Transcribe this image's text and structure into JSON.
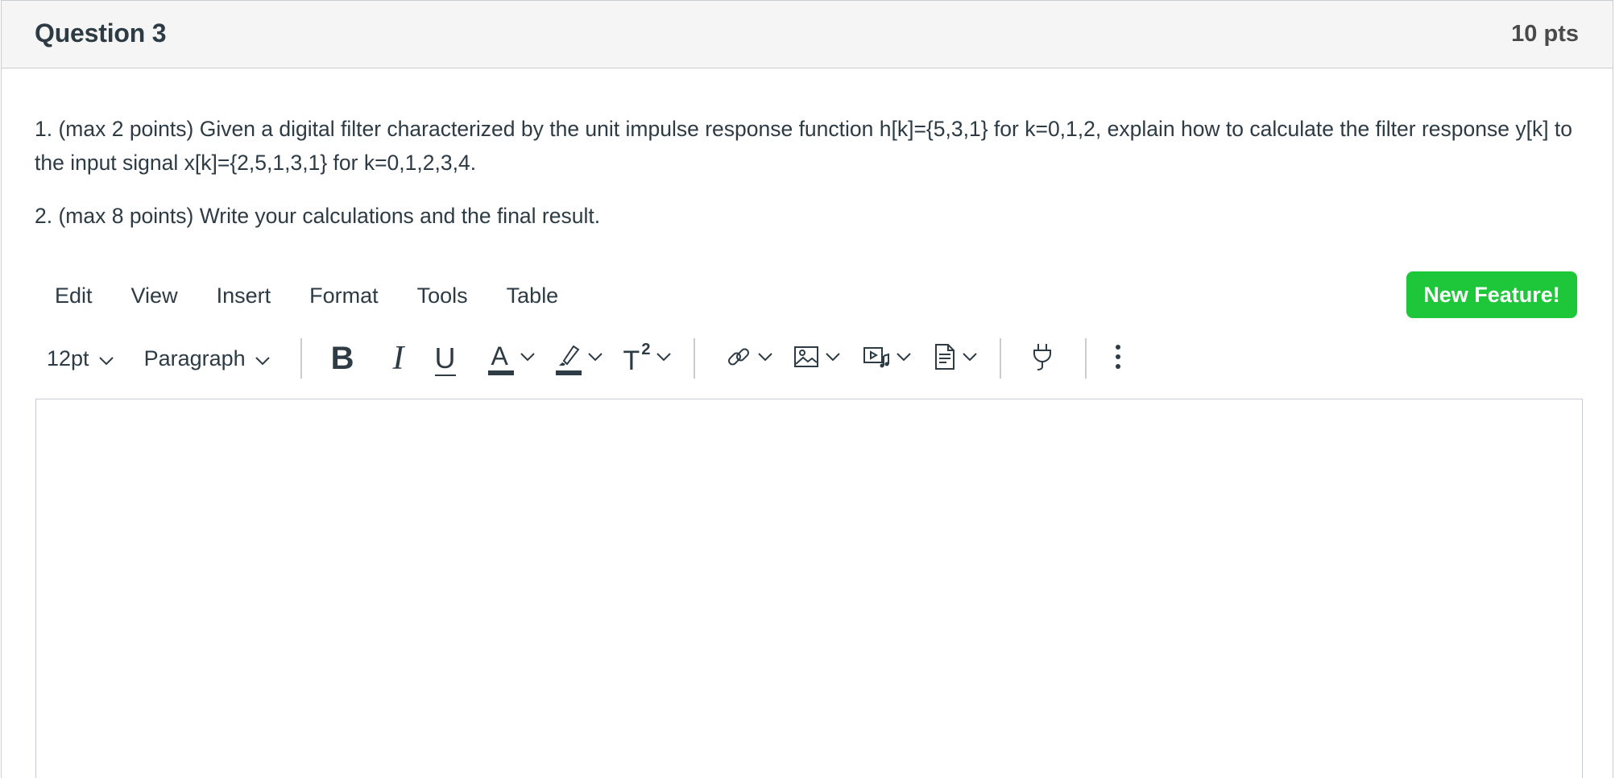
{
  "question": {
    "title": "Question 3",
    "points": "10 pts",
    "paragraphs": [
      "1. (max 2 points) Given a digital filter characterized by the unit impulse response function h[k]={5,3,1} for k=0,1,2, explain how to calculate the filter response y[k] to the input signal x[k]={2,5,1,3,1} for k=0,1,2,3,4.",
      "2. (max 8 points) Write your calculations and the final result."
    ]
  },
  "editor": {
    "menu": [
      "Edit",
      "View",
      "Insert",
      "Format",
      "Tools",
      "Table"
    ],
    "new_feature_label": "New Feature!",
    "toolbar": {
      "font_size": "12pt",
      "block_format": "Paragraph",
      "bold_glyph": "B",
      "italic_glyph": "I",
      "underline_glyph": "U",
      "text_color_glyph": "A",
      "superscript_glyph": "T",
      "superscript_exp": "2"
    },
    "content": ""
  },
  "colors": {
    "accent_green": "#1ec73a",
    "text": "#2d3b45",
    "border": "#c7cdd1",
    "header_bg": "#f5f5f5"
  },
  "icons": {
    "link": "link-icon",
    "image": "image-icon",
    "media": "media-icon",
    "document": "document-icon",
    "plugin": "plug-icon",
    "more": "more-vertical-icon",
    "highlight": "highlighter-icon"
  }
}
